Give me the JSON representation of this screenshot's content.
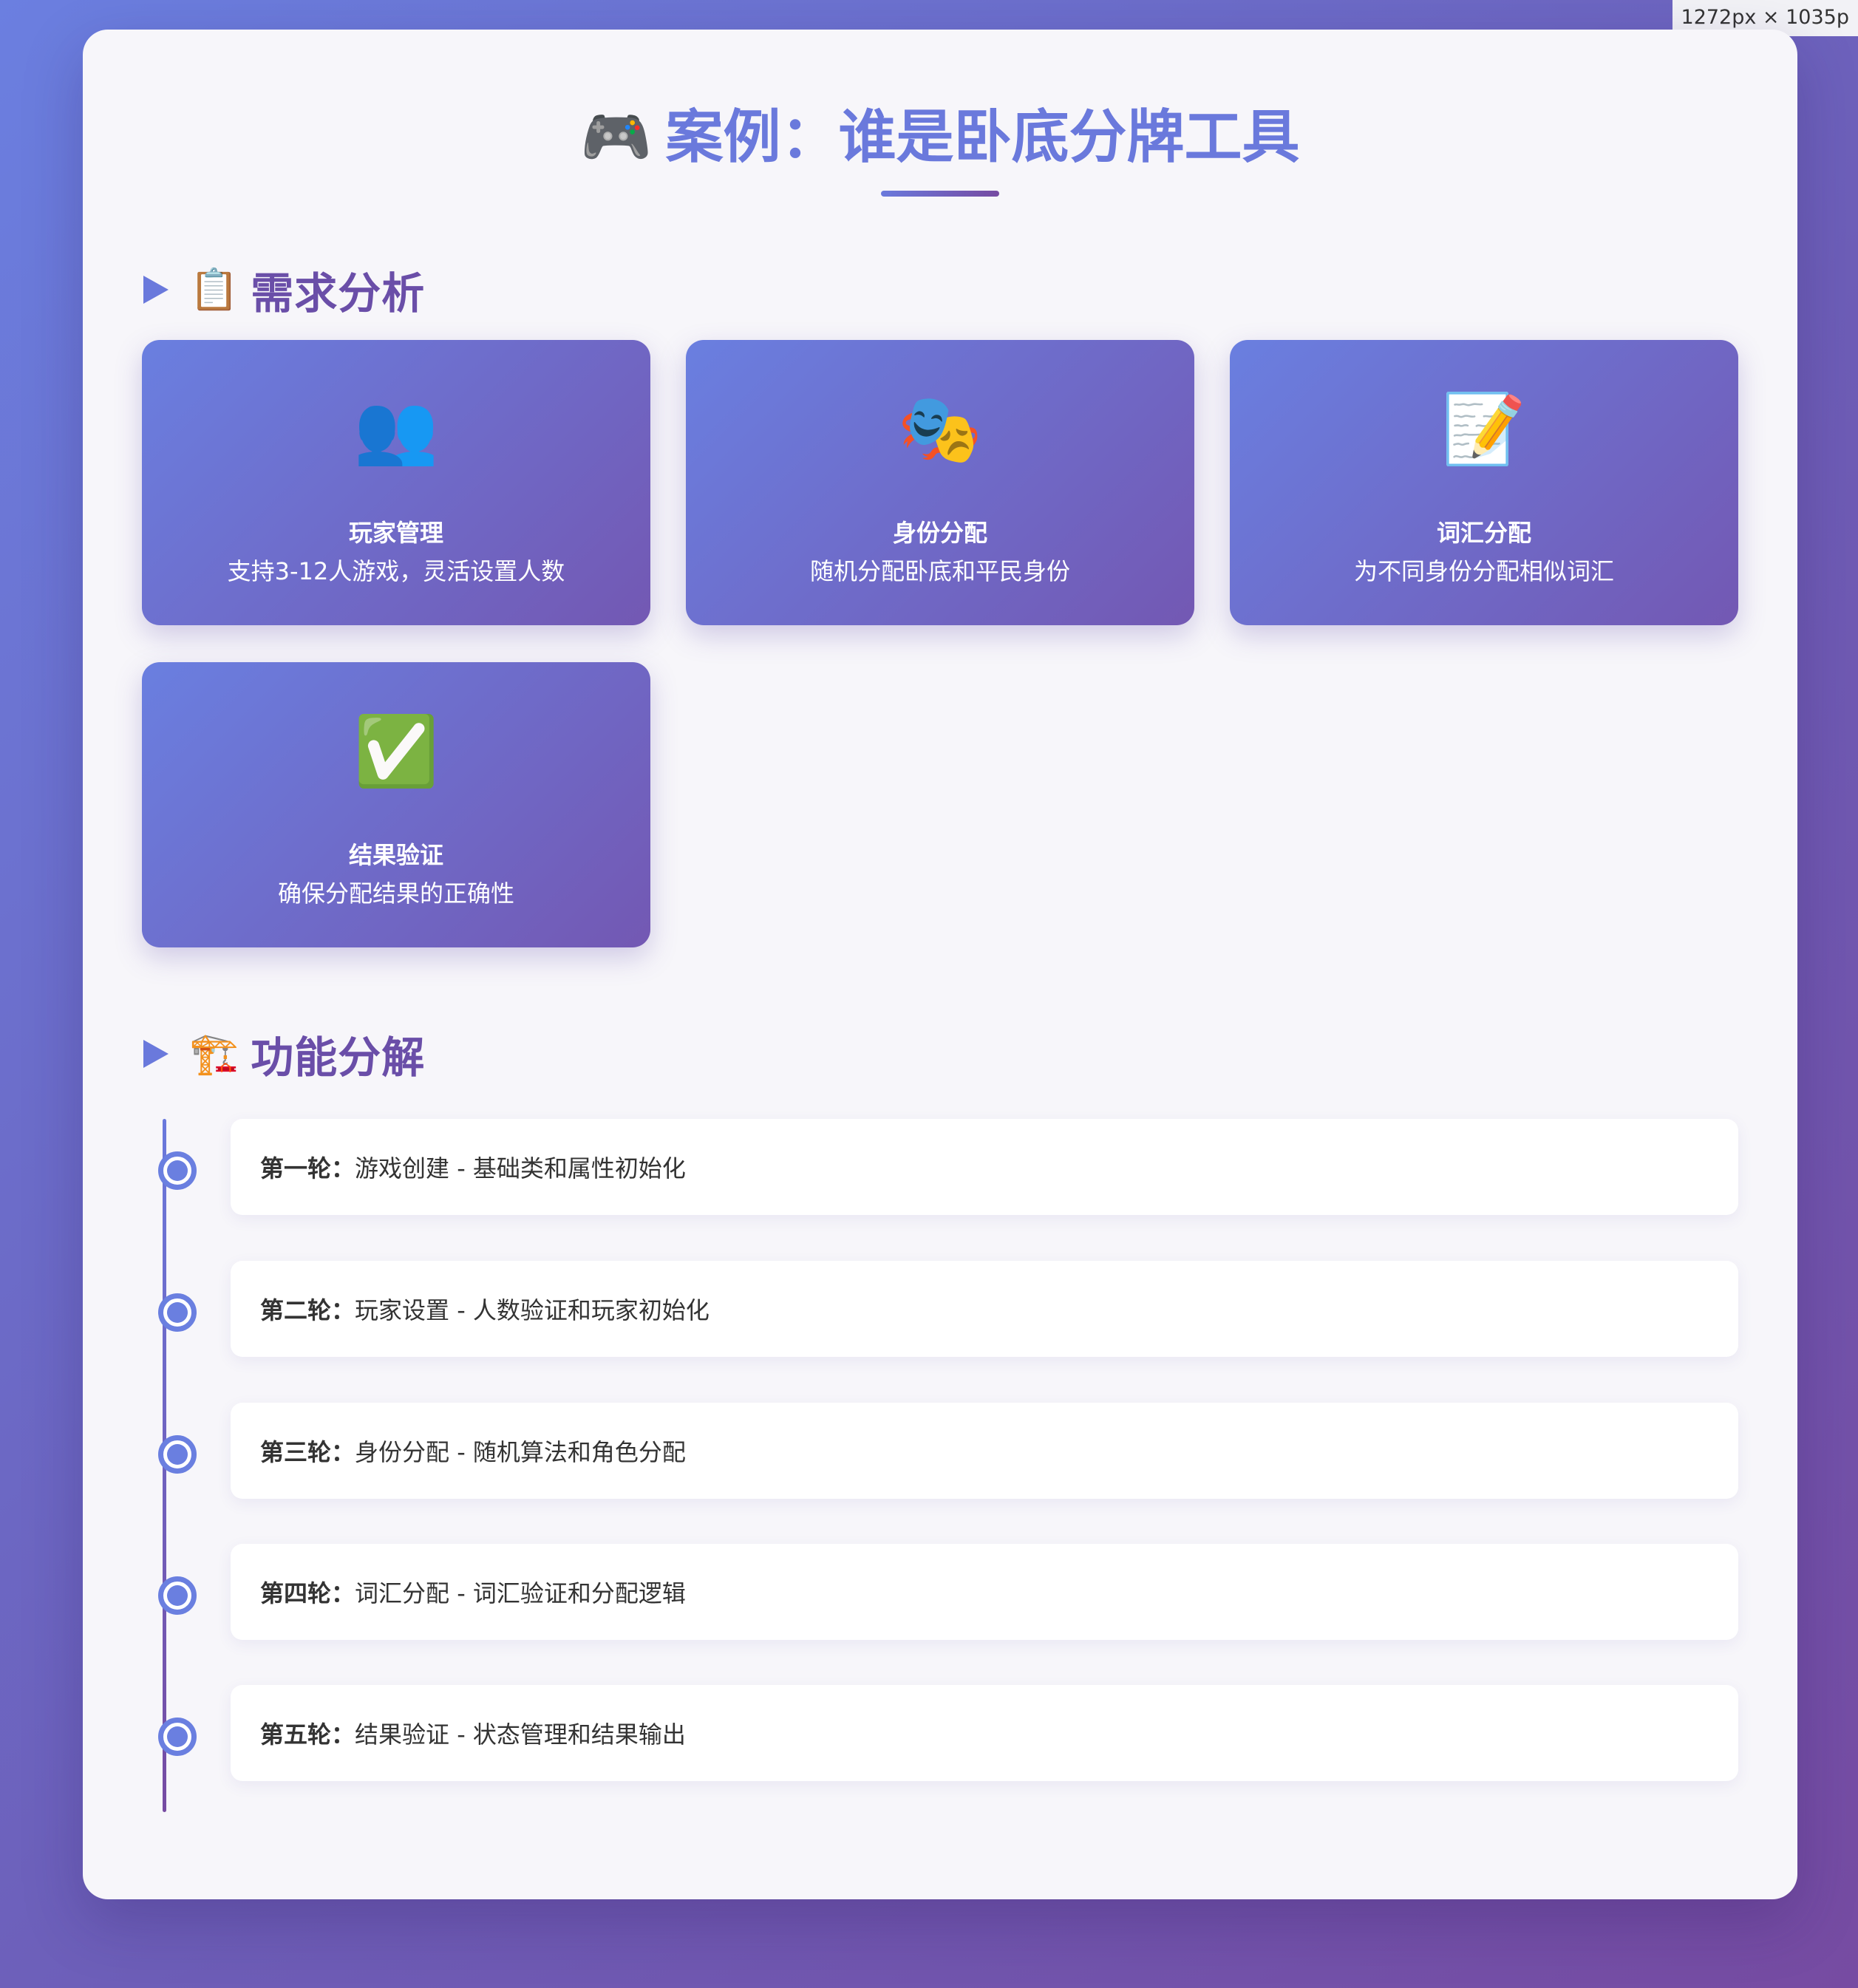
{
  "size_tag": "1272px × 1035p",
  "header": {
    "icon": "🎮",
    "icon_name": "game-controller-icon",
    "title": "案例：谁是卧底分牌工具"
  },
  "requirements": {
    "icon": "📋",
    "icon_name": "clipboard-icon",
    "title": "需求分析",
    "cards": [
      {
        "icon": "👥",
        "icon_name": "users-icon",
        "title": "玩家管理",
        "desc": "支持3-12人游戏，灵活设置人数"
      },
      {
        "icon": "🎭",
        "icon_name": "theater-masks-icon",
        "title": "身份分配",
        "desc": "随机分配卧底和平民身份"
      },
      {
        "icon": "📝",
        "icon_name": "memo-icon",
        "title": "词汇分配",
        "desc": "为不同身份分配相似词汇"
      },
      {
        "icon": "✅",
        "icon_name": "check-mark-icon",
        "title": "结果验证",
        "desc": "确保分配结果的正确性"
      }
    ]
  },
  "functions": {
    "icon": "🏗️",
    "icon_name": "construction-crane-icon",
    "title": "功能分解",
    "steps": [
      {
        "round": "第一轮：",
        "text": "游戏创建 - 基础类和属性初始化"
      },
      {
        "round": "第二轮：",
        "text": "玩家设置 - 人数验证和玩家初始化"
      },
      {
        "round": "第三轮：",
        "text": "身份分配 - 随机算法和角色分配"
      },
      {
        "round": "第四轮：",
        "text": "词汇分配 - 词汇验证和分配逻辑"
      },
      {
        "round": "第五轮：",
        "text": "结果验证 - 状态管理和结果输出"
      }
    ]
  },
  "colors": {
    "accent": "#6a79dc",
    "accent_dark": "#764ba2",
    "section_title": "#6a4ea8"
  }
}
